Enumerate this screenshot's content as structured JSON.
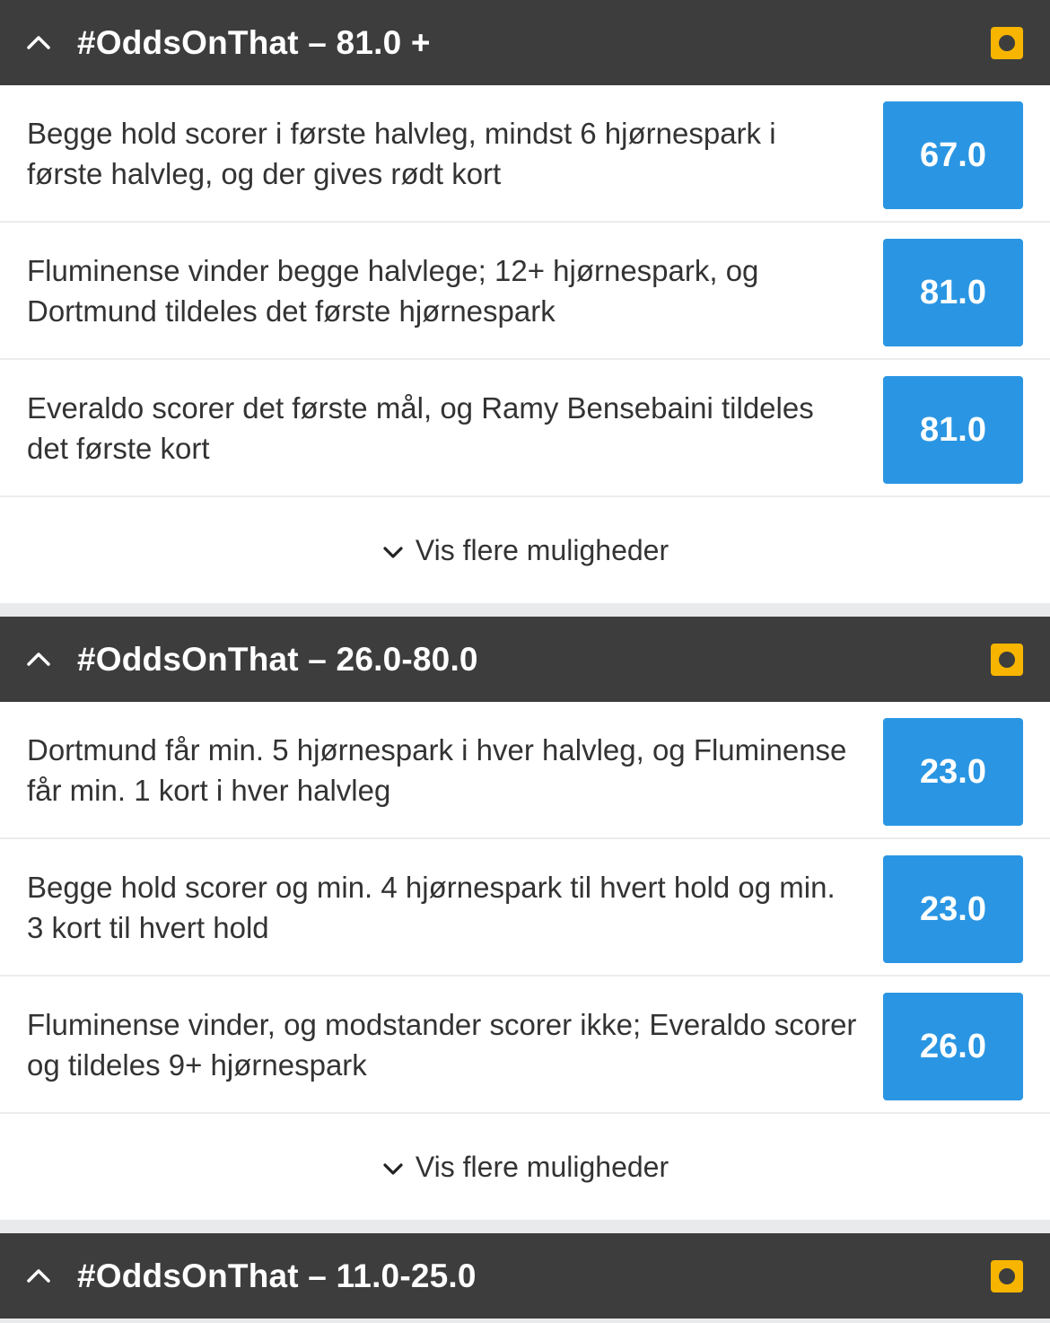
{
  "sections": [
    {
      "title": "#OddsOnThat – 81.0 +",
      "bets": [
        {
          "text": "Begge hold scorer i første halvleg, mindst 6 hjørnespark i første halvleg, og der gives rødt kort",
          "odds": "67.0"
        },
        {
          "text": "Fluminense vinder begge halvlege; 12+ hjørnespark, og Dortmund tildeles det første hjørnespark",
          "odds": "81.0"
        },
        {
          "text": "Everaldo scorer det første mål, og Ramy Bensebaini tildeles det første kort",
          "odds": "81.0"
        }
      ],
      "show_more_label": "Vis flere muligheder"
    },
    {
      "title": "#OddsOnThat – 26.0-80.0",
      "bets": [
        {
          "text": "Dortmund får min. 5 hjørnespark i hver halvleg, og Fluminense får min. 1 kort i hver halvleg",
          "odds": "23.0"
        },
        {
          "text": "Begge hold scorer og min. 4 hjørnespark til hvert hold og min. 3 kort til hvert hold",
          "odds": "23.0"
        },
        {
          "text": "Fluminense vinder, og modstander scorer ikke; Everaldo scorer og tildeles 9+ hjørnespark",
          "odds": "26.0"
        }
      ],
      "show_more_label": "Vis flere muligheder"
    },
    {
      "title": "#OddsOnThat – 11.0-25.0"
    }
  ],
  "icons": {
    "collapse": "chevron-up-icon",
    "live": "live-indicator-icon",
    "expand": "chevron-down-icon"
  },
  "colors": {
    "header_bg": "#3d3d3d",
    "odds_button": "#2a96e3",
    "live_badge": "#f7b500"
  }
}
